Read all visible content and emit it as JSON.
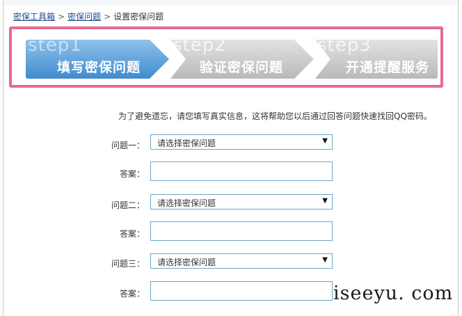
{
  "breadcrumb": {
    "items": [
      "密保工具箱",
      "密保问题",
      "设置密保问题"
    ],
    "separator": ">"
  },
  "steps": [
    {
      "num": "step1",
      "title": "填写密保问题",
      "state": "active"
    },
    {
      "num": "step2",
      "title": "验证密保问题",
      "state": "inactive"
    },
    {
      "num": "step3",
      "title": "开通提醒服务",
      "state": "inactive"
    }
  ],
  "colors": {
    "active_step": "#5b9fd8",
    "inactive_step": "#c6c6c6",
    "highlight_border": "#e56a93",
    "field_border": "#6aa7c8"
  },
  "form": {
    "intro": "为了避免遗忘，请您填写真实信息，这将帮助您以后通过回答问题快速找回QQ密码。",
    "questions": [
      {
        "label": "问题一：",
        "select_value": "请选择密保问题",
        "answer_label": "答案：",
        "answer_value": ""
      },
      {
        "label": "问题二：",
        "select_value": "请选择密保问题",
        "answer_label": "答案：",
        "answer_value": ""
      },
      {
        "label": "问题三：",
        "select_value": "请选择密保问题",
        "answer_label": "答案：",
        "answer_value": ""
      }
    ]
  },
  "watermark": "iseeyu. com"
}
